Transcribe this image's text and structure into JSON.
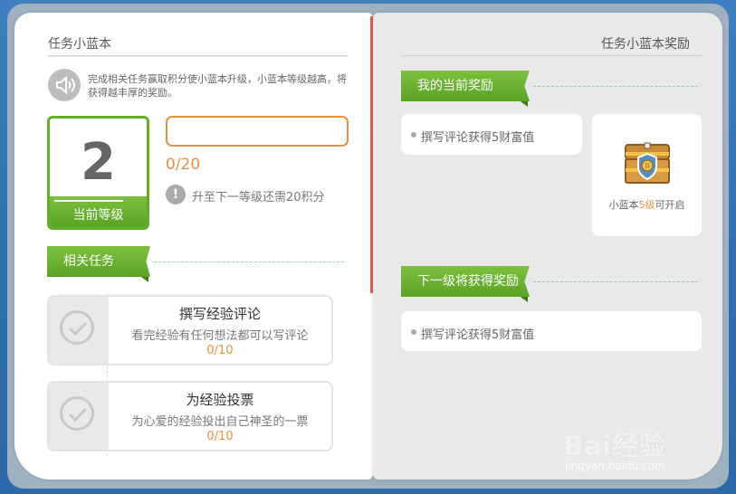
{
  "left": {
    "title": "任务小蓝本",
    "intro": "完成相关任务赢取积分使小蓝本升级，小蓝本等级越高，将获得越丰厚的奖励。",
    "level": {
      "value": "2",
      "label": "当前等级"
    },
    "progress": {
      "current": 0,
      "total": 20,
      "text": "0/20",
      "fraction": 0
    },
    "hint": "升至下一等级还需20积分",
    "tasks_ribbon": "相关任务",
    "tasks": [
      {
        "title": "撰写经验评论",
        "desc": "看完经验有任何想法都可以写评论",
        "progress": "0/10"
      },
      {
        "title": "为经验投票",
        "desc": "为心爱的经验投出自己神圣的一票",
        "progress": "0/10"
      }
    ]
  },
  "right": {
    "title": "任务小蓝本奖励",
    "current_ribbon": "我的当前奖励",
    "current_reward": "撰写评论获得5财富值",
    "chest": {
      "prefix": "小蓝本",
      "level": "5级",
      "suffix": "可开启"
    },
    "next_ribbon": "下一级将获得奖励",
    "next_reward": "撰写评论获得5财富值"
  },
  "watermark": {
    "brand": "Bai经验",
    "url": "jingyan.baidu.com"
  },
  "colors": {
    "green": "#62ae2b",
    "orange": "#e8913a",
    "spine": "#e85a55",
    "page_bg": "#2f6fb1"
  },
  "icons": [
    "speaker-icon",
    "info-icon",
    "check-circle-icon",
    "treasure-chest-icon",
    "bullet-icon"
  ]
}
